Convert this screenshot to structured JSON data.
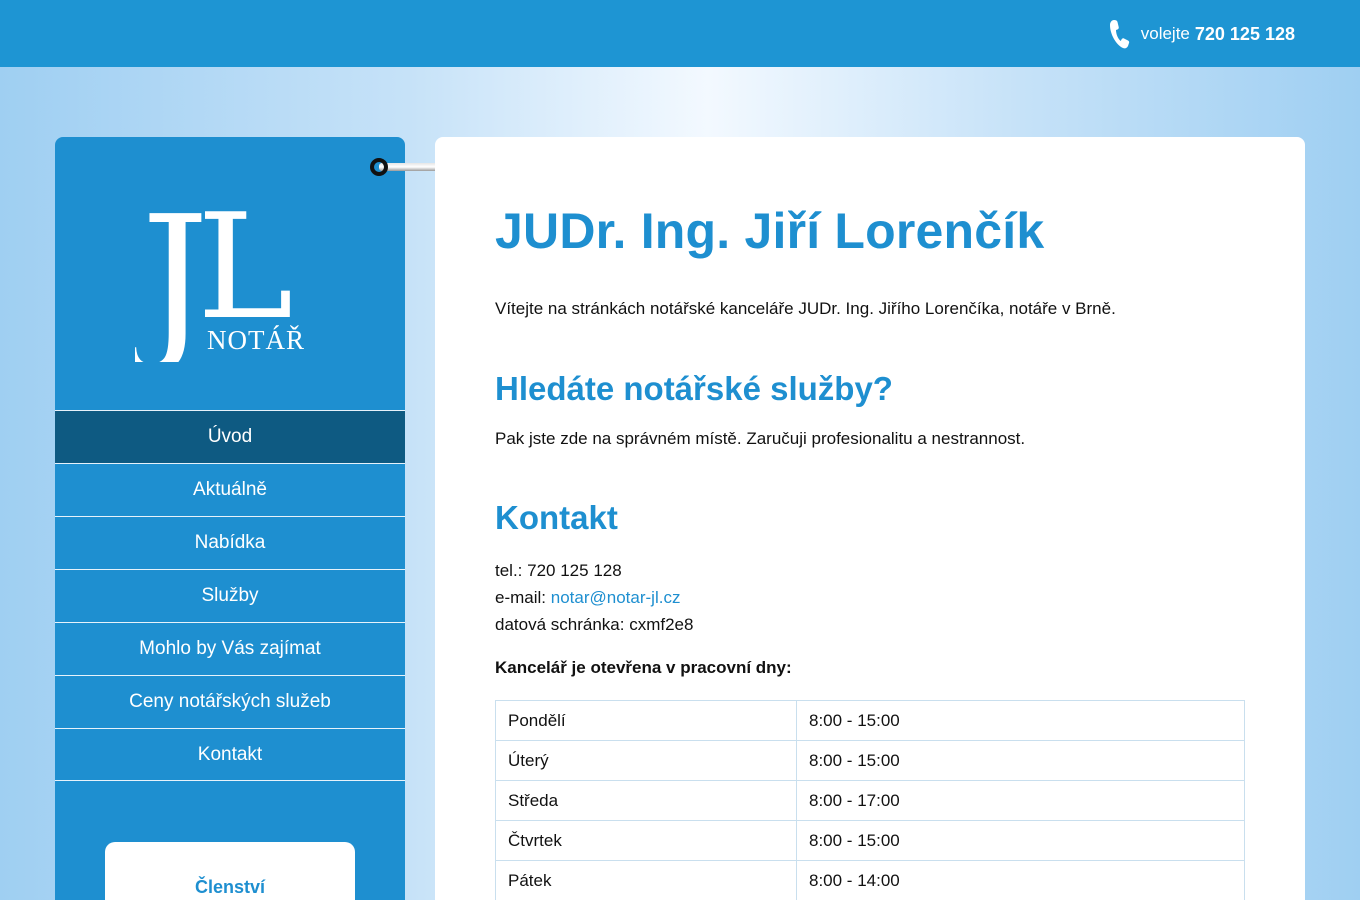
{
  "header": {
    "phone_prefix": "volejte",
    "phone_number": "720 125 128",
    "phone_icon": "phone-icon"
  },
  "logo": {
    "monogram": "JL",
    "subtitle": "NOTÁŘ"
  },
  "nav": {
    "items": [
      {
        "label": "Úvod",
        "active": true
      },
      {
        "label": "Aktuálně",
        "active": false
      },
      {
        "label": "Nabídka",
        "active": false
      },
      {
        "label": "Služby",
        "active": false
      },
      {
        "label": "Mohlo by Vás zajímat",
        "active": false
      },
      {
        "label": "Ceny notářských služeb",
        "active": false
      },
      {
        "label": "Kontakt",
        "active": false
      }
    ]
  },
  "membership": {
    "title": "Členství"
  },
  "main": {
    "title": "JUDr. Ing. Jiří Lorenčík",
    "intro": "Vítejte na stránkách notářské kanceláře JUDr. Ing. Jiřího Lorenčíka, notáře v Brně.",
    "services_heading": "Hledáte notářské služby?",
    "services_text": "Pak jste zde na správném místě. Zaručuji profesionalitu a nestrannost.",
    "contact_heading": "Kontakt",
    "contact": {
      "tel_label": "tel.:",
      "tel": "720 125 128",
      "email_label": "e-mail:",
      "email": "notar@notar-jl.cz",
      "databox_label": "datová schránka:",
      "databox": "cxmf2e8"
    },
    "hours_title": "Kancelář je otevřena v pracovní dny:",
    "hours": [
      {
        "day": "Pondělí",
        "time": "8:00 - 15:00"
      },
      {
        "day": "Úterý",
        "time": "8:00 - 15:00"
      },
      {
        "day": "Středa",
        "time": "8:00 - 17:00"
      },
      {
        "day": "Čtvrtek",
        "time": "8:00 - 15:00"
      },
      {
        "day": "Pátek",
        "time": "8:00 - 14:00"
      }
    ]
  },
  "colors": {
    "brand_blue": "#1e8fd0",
    "active_nav": "#0e5a82",
    "topbar": "#1e95d3"
  }
}
